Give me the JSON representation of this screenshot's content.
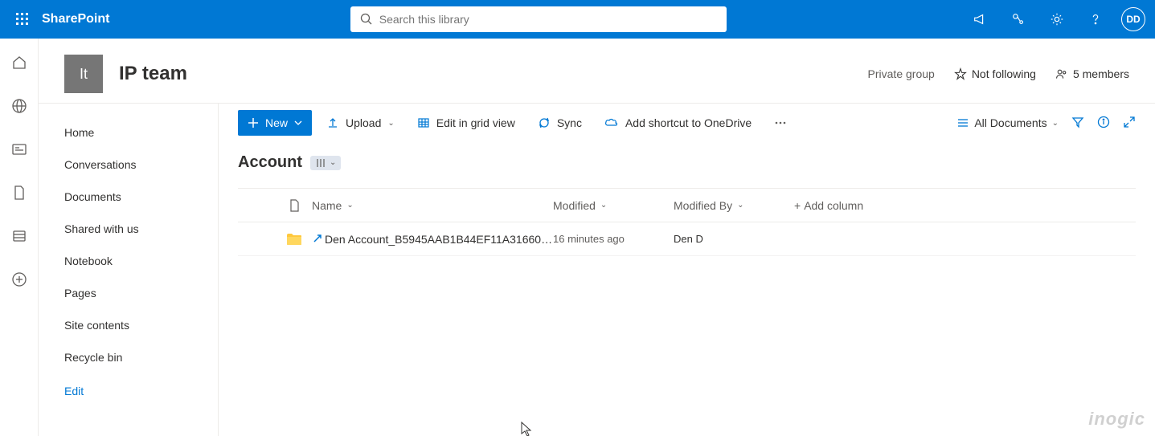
{
  "app": {
    "name": "SharePoint"
  },
  "search": {
    "placeholder": "Search this library"
  },
  "user": {
    "initials": "DD"
  },
  "site": {
    "logo_text": "It",
    "title": "IP team",
    "privacy": "Private group",
    "follow": "Not following",
    "members": "5 members"
  },
  "nav": {
    "items": [
      "Home",
      "Conversations",
      "Documents",
      "Shared with us",
      "Notebook",
      "Pages",
      "Site contents",
      "Recycle bin"
    ],
    "edit": "Edit"
  },
  "cmd": {
    "new": "New",
    "upload": "Upload",
    "edit_grid": "Edit in grid view",
    "sync": "Sync",
    "shortcut": "Add shortcut to OneDrive",
    "view": "All Documents"
  },
  "list": {
    "title": "Account",
    "columns": {
      "name": "Name",
      "modified": "Modified",
      "modified_by": "Modified By",
      "add": "Add column"
    },
    "rows": [
      {
        "name": "Den Account_B5945AAB1B44EF11A316604…",
        "modified": "16 minutes ago",
        "modified_by": "Den D"
      }
    ]
  },
  "watermark": "inogic"
}
